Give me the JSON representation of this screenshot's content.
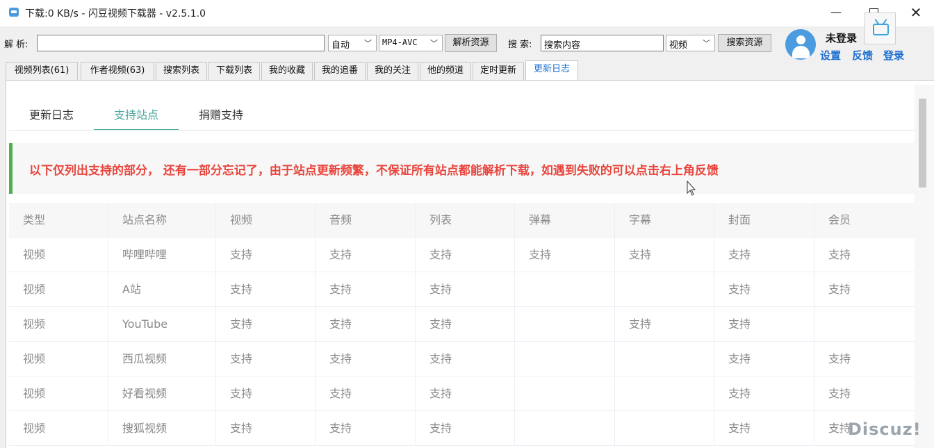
{
  "window": {
    "title": "下载:0 KB/s - 闪豆视频下载器 - v2.5.1.0",
    "minimize": "—",
    "close": "✕"
  },
  "toolbar": {
    "parse_label": "解 析:",
    "parse_value": "",
    "quality_value": "自动",
    "format_value": "MP4-AVC",
    "parse_button": "解析资源",
    "search_label": "搜 索:",
    "search_value": "搜索内容",
    "search_type_value": "视频",
    "search_button": "搜索资源",
    "dropdown_icon": "chevron-down-icon"
  },
  "user": {
    "status": "未登录",
    "settings": "设置",
    "feedback": "反馈",
    "login": "登录"
  },
  "tabs": [
    "视频列表(61)",
    "作者视频(63)",
    "搜索列表",
    "下载列表",
    "我的收藏",
    "我的追番",
    "我的关注",
    "他的频道",
    "定时更新",
    "更新日志"
  ],
  "active_tab": "更新日志",
  "subtabs": [
    "更新日志",
    "支持站点",
    "捐赠支持"
  ],
  "active_subtab": "支持站点",
  "notice": "以下仅列出支持的部分， 还有一部分忘记了，由于站点更新频繁，不保证所有站点都能解析下载，如遇到失败的可以点击右上角反馈",
  "table": {
    "headers": [
      "类型",
      "站点名称",
      "视频",
      "音频",
      "列表",
      "弹幕",
      "字幕",
      "封面",
      "会员"
    ],
    "rows": [
      [
        "视频",
        "哔哩哔哩",
        "支持",
        "支持",
        "支持",
        "支持",
        "支持",
        "支持",
        "支持"
      ],
      [
        "视频",
        "A站",
        "支持",
        "支持",
        "支持",
        "",
        "",
        "支持",
        "支持"
      ],
      [
        "视频",
        "YouTube",
        "支持",
        "支持",
        "支持",
        "",
        "支持",
        "支持",
        ""
      ],
      [
        "视频",
        "西瓜视频",
        "支持",
        "支持",
        "支持",
        "",
        "",
        "支持",
        "支持"
      ],
      [
        "视频",
        "好看视频",
        "支持",
        "支持",
        "支持",
        "",
        "",
        "支持",
        "支持"
      ],
      [
        "视频",
        "搜狐视频",
        "支持",
        "支持",
        "支持",
        "",
        "",
        "支持",
        "支持"
      ]
    ]
  },
  "watermark": "Discuz!",
  "colors": {
    "accent_teal": "#4aa89d",
    "notice_red": "#e8453c",
    "notice_bar_green": "#4caf50",
    "link_blue": "#1b6fd1"
  }
}
